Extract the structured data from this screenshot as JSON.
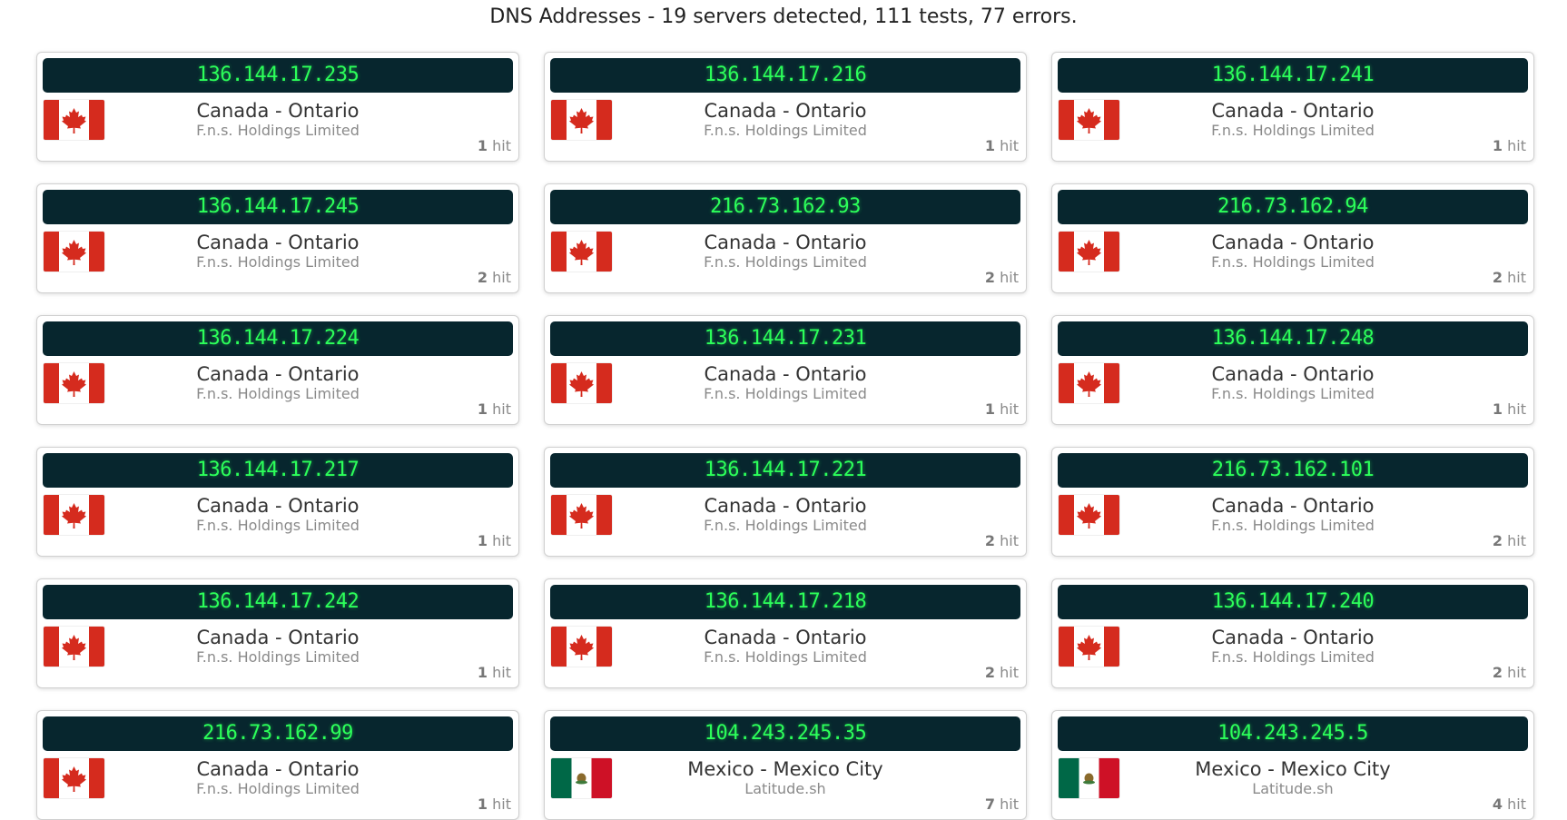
{
  "header": {
    "title": "DNS Addresses - 19 servers detected, 111 tests, 77 errors."
  },
  "colors": {
    "ip_bar_background": "#07262e",
    "ip_text": "#2cff5a"
  },
  "servers": [
    {
      "ip": "136.144.17.235",
      "location": "Canada - Ontario",
      "org": "F.n.s. Holdings Limited",
      "hit_count": "1",
      "hit_label": "hit",
      "flag": "canada-flag-icon"
    },
    {
      "ip": "136.144.17.216",
      "location": "Canada - Ontario",
      "org": "F.n.s. Holdings Limited",
      "hit_count": "1",
      "hit_label": "hit",
      "flag": "canada-flag-icon"
    },
    {
      "ip": "136.144.17.241",
      "location": "Canada - Ontario",
      "org": "F.n.s. Holdings Limited",
      "hit_count": "1",
      "hit_label": "hit",
      "flag": "canada-flag-icon"
    },
    {
      "ip": "136.144.17.245",
      "location": "Canada - Ontario",
      "org": "F.n.s. Holdings Limited",
      "hit_count": "2",
      "hit_label": "hit",
      "flag": "canada-flag-icon"
    },
    {
      "ip": "216.73.162.93",
      "location": "Canada - Ontario",
      "org": "F.n.s. Holdings Limited",
      "hit_count": "2",
      "hit_label": "hit",
      "flag": "canada-flag-icon"
    },
    {
      "ip": "216.73.162.94",
      "location": "Canada - Ontario",
      "org": "F.n.s. Holdings Limited",
      "hit_count": "2",
      "hit_label": "hit",
      "flag": "canada-flag-icon"
    },
    {
      "ip": "136.144.17.224",
      "location": "Canada - Ontario",
      "org": "F.n.s. Holdings Limited",
      "hit_count": "1",
      "hit_label": "hit",
      "flag": "canada-flag-icon"
    },
    {
      "ip": "136.144.17.231",
      "location": "Canada - Ontario",
      "org": "F.n.s. Holdings Limited",
      "hit_count": "1",
      "hit_label": "hit",
      "flag": "canada-flag-icon"
    },
    {
      "ip": "136.144.17.248",
      "location": "Canada - Ontario",
      "org": "F.n.s. Holdings Limited",
      "hit_count": "1",
      "hit_label": "hit",
      "flag": "canada-flag-icon"
    },
    {
      "ip": "136.144.17.217",
      "location": "Canada - Ontario",
      "org": "F.n.s. Holdings Limited",
      "hit_count": "1",
      "hit_label": "hit",
      "flag": "canada-flag-icon"
    },
    {
      "ip": "136.144.17.221",
      "location": "Canada - Ontario",
      "org": "F.n.s. Holdings Limited",
      "hit_count": "2",
      "hit_label": "hit",
      "flag": "canada-flag-icon"
    },
    {
      "ip": "216.73.162.101",
      "location": "Canada - Ontario",
      "org": "F.n.s. Holdings Limited",
      "hit_count": "2",
      "hit_label": "hit",
      "flag": "canada-flag-icon"
    },
    {
      "ip": "136.144.17.242",
      "location": "Canada - Ontario",
      "org": "F.n.s. Holdings Limited",
      "hit_count": "1",
      "hit_label": "hit",
      "flag": "canada-flag-icon"
    },
    {
      "ip": "136.144.17.218",
      "location": "Canada - Ontario",
      "org": "F.n.s. Holdings Limited",
      "hit_count": "2",
      "hit_label": "hit",
      "flag": "canada-flag-icon"
    },
    {
      "ip": "136.144.17.240",
      "location": "Canada - Ontario",
      "org": "F.n.s. Holdings Limited",
      "hit_count": "2",
      "hit_label": "hit",
      "flag": "canada-flag-icon"
    },
    {
      "ip": "216.73.162.99",
      "location": "Canada - Ontario",
      "org": "F.n.s. Holdings Limited",
      "hit_count": "1",
      "hit_label": "hit",
      "flag": "canada-flag-icon"
    },
    {
      "ip": "104.243.245.35",
      "location": "Mexico - Mexico City",
      "org": "Latitude.sh",
      "hit_count": "7",
      "hit_label": "hit",
      "flag": "mexico-flag-icon"
    },
    {
      "ip": "104.243.245.5",
      "location": "Mexico - Mexico City",
      "org": "Latitude.sh",
      "hit_count": "4",
      "hit_label": "hit",
      "flag": "mexico-flag-icon"
    }
  ]
}
